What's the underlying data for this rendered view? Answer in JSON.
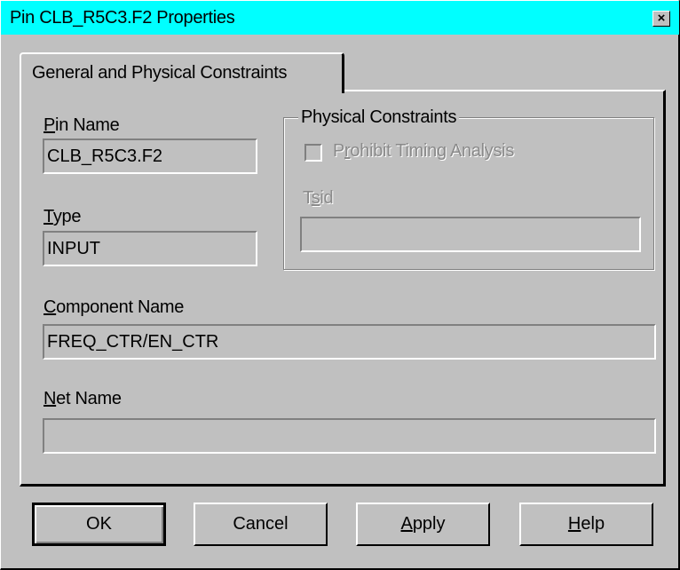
{
  "window": {
    "title": "Pin CLB_R5C3.F2 Properties",
    "close_glyph": "×"
  },
  "tabs": [
    {
      "label": "General and Physical Constraints",
      "selected": true
    }
  ],
  "general": {
    "pin_name_label": "Pin Name",
    "pin_name_value": "CLB_R5C3.F2",
    "type_label": "Type",
    "type_value": "INPUT",
    "component_name_label": "Component Name",
    "component_name_value": "FREQ_CTR/EN_CTR",
    "net_name_label": "Net Name",
    "net_name_value": ""
  },
  "physical_constraints": {
    "group_title": "Physical Constraints",
    "prohibit_timing_label": "Prohibit Timing Analysis",
    "prohibit_timing_checked": false,
    "tsid_label": "Tsid",
    "tsid_value": "",
    "enabled": false
  },
  "buttons": {
    "ok": "OK",
    "cancel": "Cancel",
    "apply": "Apply",
    "help": "Help"
  },
  "colors": {
    "title_bar": "#00ffff",
    "dialog_face": "#c0c0c0",
    "disabled_text": "#8a8a8a"
  },
  "icons": {
    "close": "close-icon"
  }
}
